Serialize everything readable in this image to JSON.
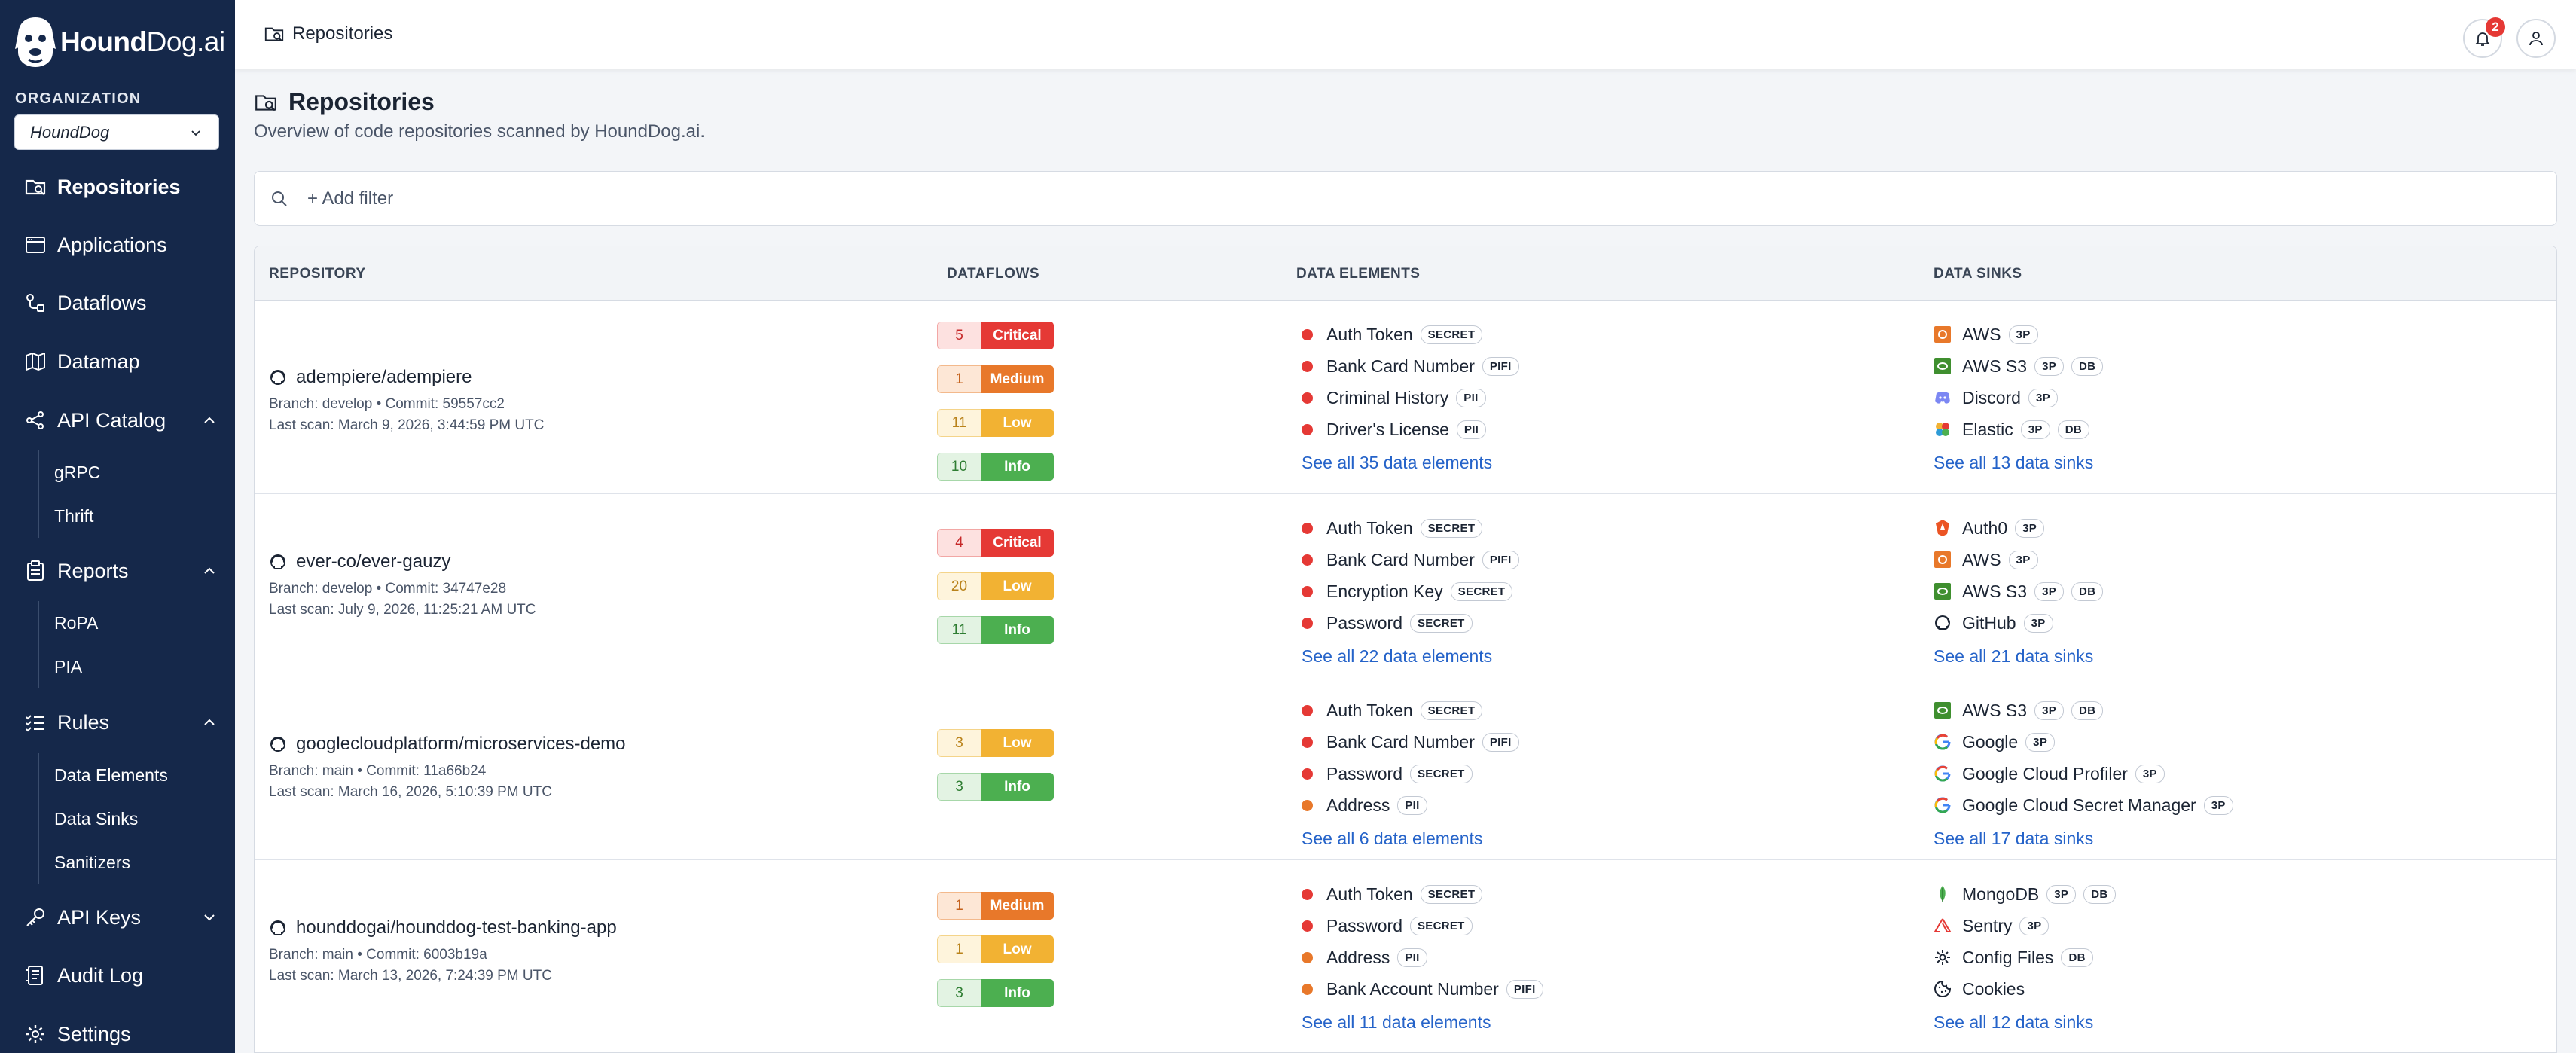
{
  "app": {
    "logo_bold": "Hound",
    "logo_rest": "Dog.ai"
  },
  "sidebar": {
    "org_label": "ORGANIZATION",
    "org_value": "HoundDog",
    "nav": {
      "repositories": "Repositories",
      "applications": "Applications",
      "dataflows": "Dataflows",
      "datamap": "Datamap",
      "api_catalog": "API Catalog",
      "api_catalog_sub": [
        "gRPC",
        "Thrift"
      ],
      "reports": "Reports",
      "reports_sub": [
        "RoPA",
        "PIA"
      ],
      "rules": "Rules",
      "rules_sub": [
        "Data Elements",
        "Data Sinks",
        "Sanitizers"
      ],
      "api_keys": "API Keys",
      "audit_log": "Audit Log",
      "settings": "Settings"
    }
  },
  "header": {
    "breadcrumb": "Repositories",
    "notification_count": "2"
  },
  "page": {
    "title": "Repositories",
    "subtitle": "Overview of code repositories scanned by HoundDog.ai.",
    "filter_placeholder": "+ Add filter"
  },
  "colors": {
    "sidebar": "#15284a",
    "critical": "#e53935",
    "medium": "#e8782a",
    "low": "#f2b233",
    "info": "#4caf50",
    "link": "#2563c9"
  },
  "table": {
    "headers": {
      "repository": "REPOSITORY",
      "dataflows": "DATAFLOWS",
      "data_elements": "DATA ELEMENTS",
      "data_sinks": "DATA SINKS"
    },
    "rows": [
      {
        "name": "adempiere/adempiere",
        "branch_line": "Branch: develop • Commit: 59557cc2",
        "scan_line": "Last scan: March 9, 2026, 3:44:59 PM UTC",
        "flows": [
          {
            "count": "5",
            "label": "Critical",
            "level": "critical"
          },
          {
            "count": "1",
            "label": "Medium",
            "level": "medium"
          },
          {
            "count": "11",
            "label": "Low",
            "level": "low"
          },
          {
            "count": "10",
            "label": "Info",
            "level": "info"
          }
        ],
        "elements": [
          {
            "name": "Auth Token",
            "tag": "SECRET",
            "color": "#e53935"
          },
          {
            "name": "Bank Card Number",
            "tag": "PIFI",
            "color": "#e53935"
          },
          {
            "name": "Criminal History",
            "tag": "PII",
            "color": "#e53935"
          },
          {
            "name": "Driver's License",
            "tag": "PII",
            "color": "#e53935"
          }
        ],
        "elements_link": "See all 35 data elements",
        "sinks": [
          {
            "name": "AWS",
            "tags": [
              "3P"
            ],
            "icon": "aws-icon"
          },
          {
            "name": "AWS S3",
            "tags": [
              "3P",
              "DB"
            ],
            "icon": "aws-s3-icon"
          },
          {
            "name": "Discord",
            "tags": [
              "3P"
            ],
            "icon": "discord-icon"
          },
          {
            "name": "Elastic",
            "tags": [
              "3P",
              "DB"
            ],
            "icon": "elastic-icon"
          }
        ],
        "sinks_link": "See all 13 data sinks"
      },
      {
        "name": "ever-co/ever-gauzy",
        "branch_line": "Branch: develop • Commit: 34747e28",
        "scan_line": "Last scan: July 9, 2026, 11:25:21 AM UTC",
        "flows": [
          {
            "count": "4",
            "label": "Critical",
            "level": "critical"
          },
          {
            "count": "20",
            "label": "Low",
            "level": "low"
          },
          {
            "count": "11",
            "label": "Info",
            "level": "info"
          }
        ],
        "elements": [
          {
            "name": "Auth Token",
            "tag": "SECRET",
            "color": "#e53935"
          },
          {
            "name": "Bank Card Number",
            "tag": "PIFI",
            "color": "#e53935"
          },
          {
            "name": "Encryption Key",
            "tag": "SECRET",
            "color": "#e53935"
          },
          {
            "name": "Password",
            "tag": "SECRET",
            "color": "#e53935"
          }
        ],
        "elements_link": "See all 22 data elements",
        "sinks": [
          {
            "name": "Auth0",
            "tags": [
              "3P"
            ],
            "icon": "auth0-icon"
          },
          {
            "name": "AWS",
            "tags": [
              "3P"
            ],
            "icon": "aws-icon"
          },
          {
            "name": "AWS S3",
            "tags": [
              "3P",
              "DB"
            ],
            "icon": "aws-s3-icon"
          },
          {
            "name": "GitHub",
            "tags": [
              "3P"
            ],
            "icon": "github-icon"
          }
        ],
        "sinks_link": "See all 21 data sinks"
      },
      {
        "name": "googlecloudplatform/microservices-demo",
        "branch_line": "Branch: main • Commit: 11a66b24",
        "scan_line": "Last scan: March 16, 2026, 5:10:39 PM UTC",
        "flows": [
          {
            "count": "3",
            "label": "Low",
            "level": "low"
          },
          {
            "count": "3",
            "label": "Info",
            "level": "info"
          }
        ],
        "elements": [
          {
            "name": "Auth Token",
            "tag": "SECRET",
            "color": "#e53935"
          },
          {
            "name": "Bank Card Number",
            "tag": "PIFI",
            "color": "#e53935"
          },
          {
            "name": "Password",
            "tag": "SECRET",
            "color": "#e53935"
          },
          {
            "name": "Address",
            "tag": "PII",
            "color": "#e8782a"
          }
        ],
        "elements_link": "See all 6 data elements",
        "sinks": [
          {
            "name": "AWS S3",
            "tags": [
              "3P",
              "DB"
            ],
            "icon": "aws-s3-icon"
          },
          {
            "name": "Google",
            "tags": [
              "3P"
            ],
            "icon": "google-icon"
          },
          {
            "name": "Google Cloud Profiler",
            "tags": [
              "3P"
            ],
            "icon": "google-icon"
          },
          {
            "name": "Google Cloud Secret Manager",
            "tags": [
              "3P"
            ],
            "icon": "google-icon"
          }
        ],
        "sinks_link": "See all 17 data sinks"
      },
      {
        "name": "hounddogai/hounddog-test-banking-app",
        "branch_line": "Branch: main • Commit: 6003b19a",
        "scan_line": "Last scan: March 13, 2026, 7:24:39 PM UTC",
        "flows": [
          {
            "count": "1",
            "label": "Medium",
            "level": "medium"
          },
          {
            "count": "1",
            "label": "Low",
            "level": "low"
          },
          {
            "count": "3",
            "label": "Info",
            "level": "info"
          }
        ],
        "elements": [
          {
            "name": "Auth Token",
            "tag": "SECRET",
            "color": "#e53935"
          },
          {
            "name": "Password",
            "tag": "SECRET",
            "color": "#e53935"
          },
          {
            "name": "Address",
            "tag": "PII",
            "color": "#e8782a"
          },
          {
            "name": "Bank Account Number",
            "tag": "PIFI",
            "color": "#e8782a"
          }
        ],
        "elements_link": "See all 11 data elements",
        "sinks": [
          {
            "name": "MongoDB",
            "tags": [
              "3P",
              "DB"
            ],
            "icon": "mongodb-icon"
          },
          {
            "name": "Sentry",
            "tags": [
              "3P"
            ],
            "icon": "sentry-icon"
          },
          {
            "name": "Config Files",
            "tags": [
              "DB"
            ],
            "icon": "gear-icon"
          },
          {
            "name": "Cookies",
            "tags": [],
            "icon": "cookie-icon"
          }
        ],
        "sinks_link": "See all 12 data sinks"
      }
    ]
  }
}
